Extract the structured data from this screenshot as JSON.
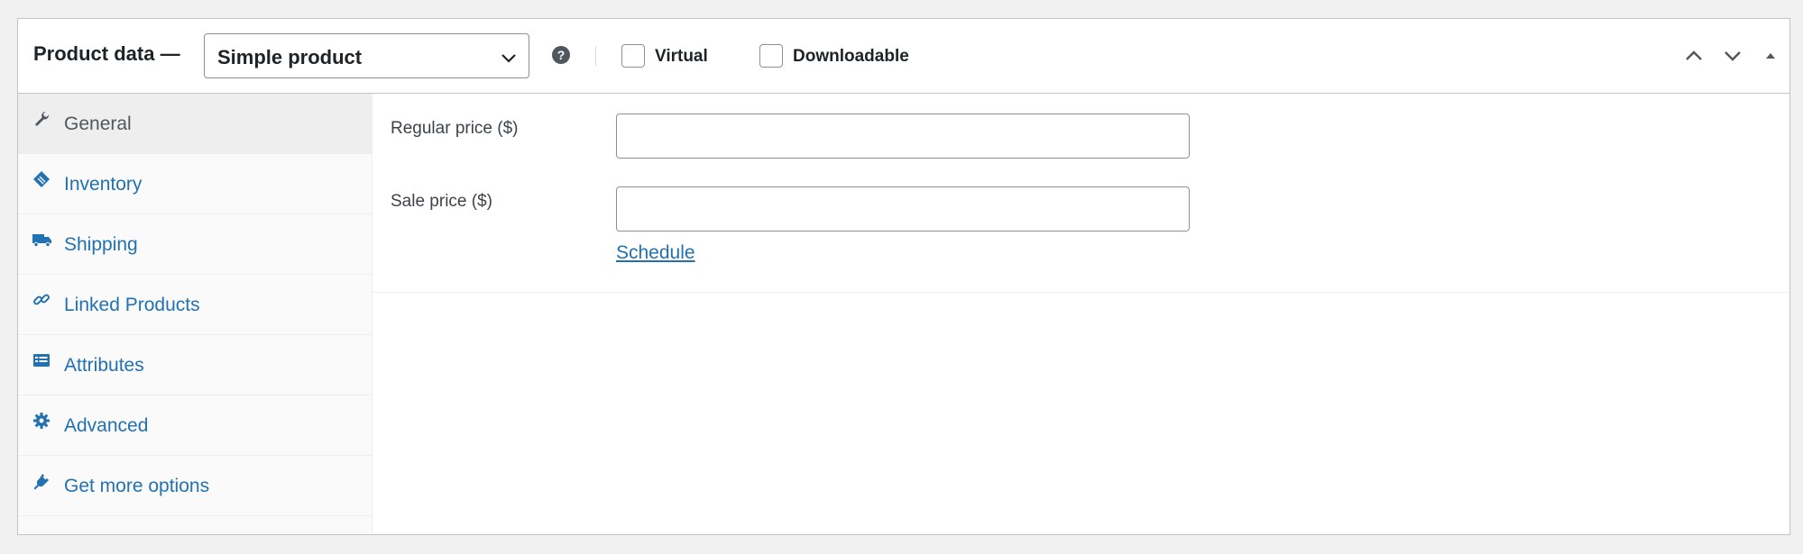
{
  "header": {
    "title": "Product data —",
    "product_type": "Simple product",
    "help_glyph": "?",
    "virtual_label": "Virtual",
    "downloadable_label": "Downloadable"
  },
  "tabs": [
    {
      "label": "General",
      "icon": "wrench-icon",
      "active": true
    },
    {
      "label": "Inventory",
      "icon": "tag-icon"
    },
    {
      "label": "Shipping",
      "icon": "truck-icon"
    },
    {
      "label": "Linked Products",
      "icon": "link-icon"
    },
    {
      "label": "Attributes",
      "icon": "list-icon"
    },
    {
      "label": "Advanced",
      "icon": "gear-icon"
    },
    {
      "label": "Get more options",
      "icon": "plug-icon"
    }
  ],
  "general": {
    "regular_price_label": "Regular price ($)",
    "regular_price_value": "",
    "sale_price_label": "Sale price ($)",
    "sale_price_value": "",
    "schedule_link": "Schedule"
  },
  "colors": {
    "link": "#2271b1",
    "active_tab_bg": "#eeeeee",
    "icon_gray": "#50575e"
  }
}
